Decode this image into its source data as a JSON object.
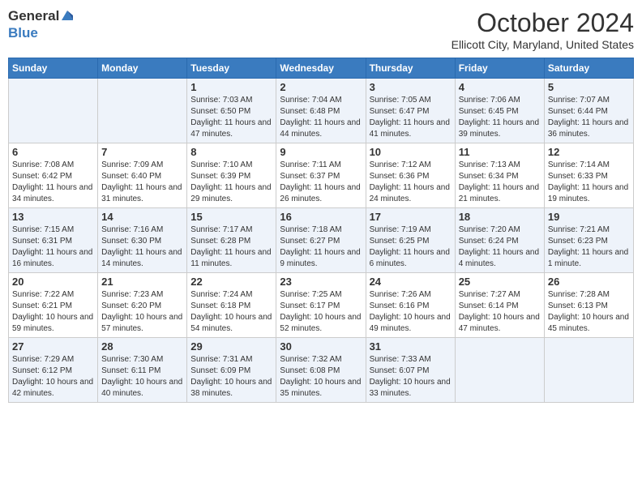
{
  "header": {
    "logo_line1": "General",
    "logo_line2": "Blue",
    "month_year": "October 2024",
    "location": "Ellicott City, Maryland, United States"
  },
  "days_of_week": [
    "Sunday",
    "Monday",
    "Tuesday",
    "Wednesday",
    "Thursday",
    "Friday",
    "Saturday"
  ],
  "weeks": [
    [
      {
        "day": "",
        "info": ""
      },
      {
        "day": "",
        "info": ""
      },
      {
        "day": "1",
        "info": "Sunrise: 7:03 AM\nSunset: 6:50 PM\nDaylight: 11 hours and 47 minutes."
      },
      {
        "day": "2",
        "info": "Sunrise: 7:04 AM\nSunset: 6:48 PM\nDaylight: 11 hours and 44 minutes."
      },
      {
        "day": "3",
        "info": "Sunrise: 7:05 AM\nSunset: 6:47 PM\nDaylight: 11 hours and 41 minutes."
      },
      {
        "day": "4",
        "info": "Sunrise: 7:06 AM\nSunset: 6:45 PM\nDaylight: 11 hours and 39 minutes."
      },
      {
        "day": "5",
        "info": "Sunrise: 7:07 AM\nSunset: 6:44 PM\nDaylight: 11 hours and 36 minutes."
      }
    ],
    [
      {
        "day": "6",
        "info": "Sunrise: 7:08 AM\nSunset: 6:42 PM\nDaylight: 11 hours and 34 minutes."
      },
      {
        "day": "7",
        "info": "Sunrise: 7:09 AM\nSunset: 6:40 PM\nDaylight: 11 hours and 31 minutes."
      },
      {
        "day": "8",
        "info": "Sunrise: 7:10 AM\nSunset: 6:39 PM\nDaylight: 11 hours and 29 minutes."
      },
      {
        "day": "9",
        "info": "Sunrise: 7:11 AM\nSunset: 6:37 PM\nDaylight: 11 hours and 26 minutes."
      },
      {
        "day": "10",
        "info": "Sunrise: 7:12 AM\nSunset: 6:36 PM\nDaylight: 11 hours and 24 minutes."
      },
      {
        "day": "11",
        "info": "Sunrise: 7:13 AM\nSunset: 6:34 PM\nDaylight: 11 hours and 21 minutes."
      },
      {
        "day": "12",
        "info": "Sunrise: 7:14 AM\nSunset: 6:33 PM\nDaylight: 11 hours and 19 minutes."
      }
    ],
    [
      {
        "day": "13",
        "info": "Sunrise: 7:15 AM\nSunset: 6:31 PM\nDaylight: 11 hours and 16 minutes."
      },
      {
        "day": "14",
        "info": "Sunrise: 7:16 AM\nSunset: 6:30 PM\nDaylight: 11 hours and 14 minutes."
      },
      {
        "day": "15",
        "info": "Sunrise: 7:17 AM\nSunset: 6:28 PM\nDaylight: 11 hours and 11 minutes."
      },
      {
        "day": "16",
        "info": "Sunrise: 7:18 AM\nSunset: 6:27 PM\nDaylight: 11 hours and 9 minutes."
      },
      {
        "day": "17",
        "info": "Sunrise: 7:19 AM\nSunset: 6:25 PM\nDaylight: 11 hours and 6 minutes."
      },
      {
        "day": "18",
        "info": "Sunrise: 7:20 AM\nSunset: 6:24 PM\nDaylight: 11 hours and 4 minutes."
      },
      {
        "day": "19",
        "info": "Sunrise: 7:21 AM\nSunset: 6:23 PM\nDaylight: 11 hours and 1 minute."
      }
    ],
    [
      {
        "day": "20",
        "info": "Sunrise: 7:22 AM\nSunset: 6:21 PM\nDaylight: 10 hours and 59 minutes."
      },
      {
        "day": "21",
        "info": "Sunrise: 7:23 AM\nSunset: 6:20 PM\nDaylight: 10 hours and 57 minutes."
      },
      {
        "day": "22",
        "info": "Sunrise: 7:24 AM\nSunset: 6:18 PM\nDaylight: 10 hours and 54 minutes."
      },
      {
        "day": "23",
        "info": "Sunrise: 7:25 AM\nSunset: 6:17 PM\nDaylight: 10 hours and 52 minutes."
      },
      {
        "day": "24",
        "info": "Sunrise: 7:26 AM\nSunset: 6:16 PM\nDaylight: 10 hours and 49 minutes."
      },
      {
        "day": "25",
        "info": "Sunrise: 7:27 AM\nSunset: 6:14 PM\nDaylight: 10 hours and 47 minutes."
      },
      {
        "day": "26",
        "info": "Sunrise: 7:28 AM\nSunset: 6:13 PM\nDaylight: 10 hours and 45 minutes."
      }
    ],
    [
      {
        "day": "27",
        "info": "Sunrise: 7:29 AM\nSunset: 6:12 PM\nDaylight: 10 hours and 42 minutes."
      },
      {
        "day": "28",
        "info": "Sunrise: 7:30 AM\nSunset: 6:11 PM\nDaylight: 10 hours and 40 minutes."
      },
      {
        "day": "29",
        "info": "Sunrise: 7:31 AM\nSunset: 6:09 PM\nDaylight: 10 hours and 38 minutes."
      },
      {
        "day": "30",
        "info": "Sunrise: 7:32 AM\nSunset: 6:08 PM\nDaylight: 10 hours and 35 minutes."
      },
      {
        "day": "31",
        "info": "Sunrise: 7:33 AM\nSunset: 6:07 PM\nDaylight: 10 hours and 33 minutes."
      },
      {
        "day": "",
        "info": ""
      },
      {
        "day": "",
        "info": ""
      }
    ]
  ]
}
